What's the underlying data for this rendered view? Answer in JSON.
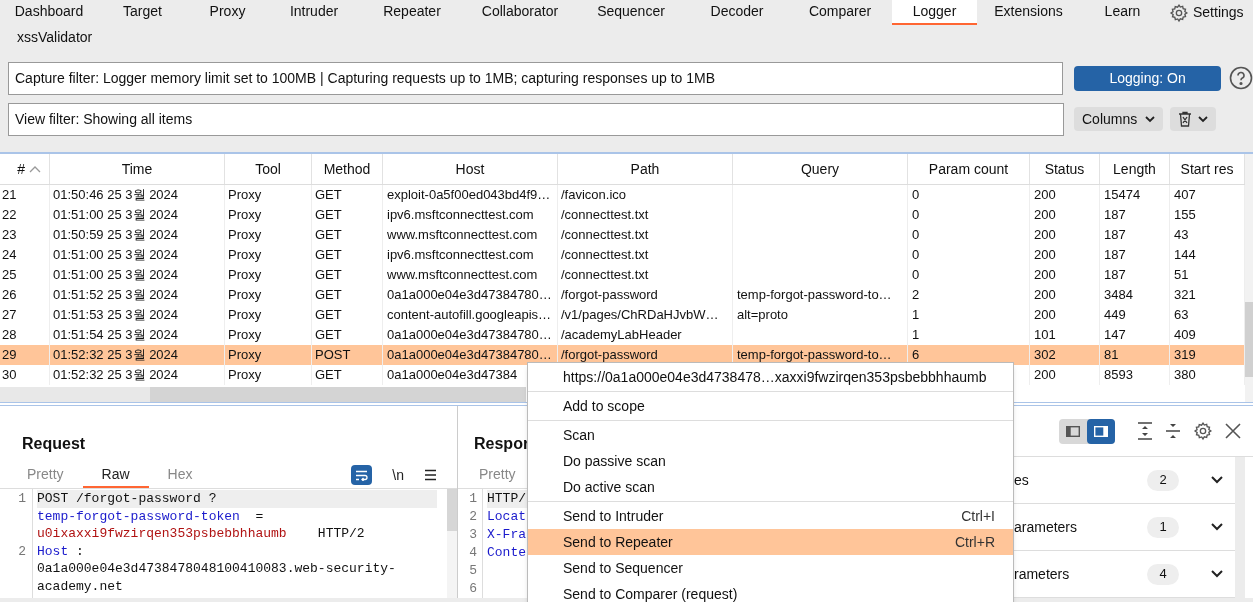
{
  "tabs": [
    {
      "label": "Dashboard",
      "selected": false
    },
    {
      "label": "Target",
      "selected": false
    },
    {
      "label": "Proxy",
      "selected": false
    },
    {
      "label": "Intruder",
      "selected": false
    },
    {
      "label": "Repeater",
      "selected": false
    },
    {
      "label": "Collaborator",
      "selected": false
    },
    {
      "label": "Sequencer",
      "selected": false
    },
    {
      "label": "Decoder",
      "selected": false
    },
    {
      "label": "Comparer",
      "selected": false
    },
    {
      "label": "Logger",
      "selected": true
    },
    {
      "label": "Extensions",
      "selected": false
    },
    {
      "label": "Learn",
      "selected": false
    }
  ],
  "settings": {
    "label": "Settings"
  },
  "tabs_row2": [
    {
      "label": "xssValidator",
      "selected": false
    }
  ],
  "capture_filter": "Capture filter: Logger memory limit set to 100MB | Capturing requests up to 1MB;  capturing responses up to 1MB",
  "logging_button": {
    "label": "Logging: On",
    "on": true
  },
  "view_filter": "View filter: Showing all items",
  "columns_button": "Columns",
  "table": {
    "columns": [
      "#",
      "Time",
      "Tool",
      "Method",
      "Host",
      "Path",
      "Query",
      "Param count",
      "Status",
      "Length",
      "Start res"
    ],
    "rows": [
      {
        "selected": false,
        "cells": [
          "21",
          "01:50:46 25 3월 2024",
          "Proxy",
          "GET",
          "exploit-0a5f00ed043bd4f9…",
          "/favicon.ico",
          "",
          "0",
          "200",
          "15474",
          "407"
        ]
      },
      {
        "selected": false,
        "cells": [
          "22",
          "01:51:00 25 3월 2024",
          "Proxy",
          "GET",
          "ipv6.msftconnecttest.com",
          "/connecttest.txt",
          "",
          "0",
          "200",
          "187",
          "155"
        ]
      },
      {
        "selected": false,
        "cells": [
          "23",
          "01:50:59 25 3월 2024",
          "Proxy",
          "GET",
          "www.msftconnecttest.com",
          "/connecttest.txt",
          "",
          "0",
          "200",
          "187",
          "43"
        ]
      },
      {
        "selected": false,
        "cells": [
          "24",
          "01:51:00 25 3월 2024",
          "Proxy",
          "GET",
          "ipv6.msftconnecttest.com",
          "/connecttest.txt",
          "",
          "0",
          "200",
          "187",
          "144"
        ]
      },
      {
        "selected": false,
        "cells": [
          "25",
          "01:51:00 25 3월 2024",
          "Proxy",
          "GET",
          "www.msftconnecttest.com",
          "/connecttest.txt",
          "",
          "0",
          "200",
          "187",
          "51"
        ]
      },
      {
        "selected": false,
        "cells": [
          "26",
          "01:51:52 25 3월 2024",
          "Proxy",
          "GET",
          "0a1a000e04e3d47384780…",
          "/forgot-password",
          "temp-forgot-password-to…",
          "2",
          "200",
          "3484",
          "321"
        ]
      },
      {
        "selected": false,
        "cells": [
          "27",
          "01:51:53 25 3월 2024",
          "Proxy",
          "GET",
          "content-autofill.googleapis…",
          "/v1/pages/ChRDaHJvbW…",
          "alt=proto",
          "1",
          "200",
          "449",
          "63"
        ]
      },
      {
        "selected": false,
        "cells": [
          "28",
          "01:51:54 25 3월 2024",
          "Proxy",
          "GET",
          "0a1a000e04e3d47384780…",
          "/academyLabHeader",
          "",
          "1",
          "101",
          "147",
          "409"
        ]
      },
      {
        "selected": true,
        "cells": [
          "29",
          "01:52:32 25 3월 2024",
          "Proxy",
          "POST",
          "0a1a000e04e3d47384780…",
          "/forgot-password",
          "temp-forgot-password-to…",
          "6",
          "302",
          "81",
          "319"
        ]
      },
      {
        "selected": false,
        "cells": [
          "30",
          "01:52:32 25 3월 2024",
          "Proxy",
          "GET",
          "0a1a000e04e3d47384",
          "",
          "",
          "",
          "200",
          "8593",
          "380"
        ]
      }
    ]
  },
  "request": {
    "title": "Request",
    "tabs": [
      {
        "label": "Pretty",
        "selected": false
      },
      {
        "label": "Raw",
        "selected": true
      },
      {
        "label": "Hex",
        "selected": false
      }
    ],
    "wrap_on": true,
    "newline_label": "\\n",
    "lines": [
      {
        "number": "1",
        "rows": [
          [
            {
              "kind": "plain",
              "text": "POST /forgot-password ?"
            }
          ],
          [
            {
              "kind": "key",
              "text": "temp-forgot-password-token"
            },
            {
              "kind": "plain",
              "text": "  ="
            }
          ],
          [
            {
              "kind": "value",
              "text": "u0ixaxxi9fwzirqen353psbebbhhaumb"
            },
            {
              "kind": "plain",
              "text": "    HTTP/2"
            }
          ]
        ]
      },
      {
        "number": "2",
        "rows": [
          [
            {
              "kind": "key",
              "text": "Host"
            },
            {
              "kind": "plain",
              "text": " :"
            }
          ],
          [
            {
              "kind": "plain",
              "text": "0a1a000e04e3d4738478048100410083.web-security-"
            }
          ],
          [
            {
              "kind": "plain",
              "text": "academy.net"
            }
          ]
        ]
      }
    ]
  },
  "response": {
    "title": "Respor",
    "tabs": [
      {
        "label": "Pretty",
        "selected": false
      }
    ],
    "lines": [
      {
        "number": "1",
        "text": "HTTP/",
        "kind": "plain"
      },
      {
        "number": "2",
        "text": "Locat",
        "kind": "key"
      },
      {
        "number": "3",
        "text": "X-Fra",
        "kind": "key"
      },
      {
        "number": "4",
        "text": "Conte",
        "kind": "key"
      },
      {
        "number": "5"
      },
      {
        "number": "6"
      }
    ]
  },
  "inspector": {
    "layout_toggle": [
      {
        "selected": false
      },
      {
        "selected": true
      }
    ],
    "sections": [
      {
        "label": "es",
        "count": "2"
      },
      {
        "label": "arameters",
        "count": "1"
      },
      {
        "label": "rameters",
        "count": "4"
      }
    ]
  },
  "context_menu": {
    "groups": [
      [
        {
          "label": "https://0a1a000e04e3d4738478…xaxxi9fwzirqen353psbebbhhaumb",
          "selected": false
        }
      ],
      [
        {
          "label": "Add to scope",
          "selected": false
        }
      ],
      [
        {
          "label": "Scan",
          "selected": false
        },
        {
          "label": "Do passive scan",
          "selected": false
        },
        {
          "label": "Do active scan",
          "selected": false
        }
      ],
      [
        {
          "label": "Send to Intruder",
          "shortcut": "Ctrl+I",
          "selected": false
        },
        {
          "label": "Send to Repeater",
          "shortcut": "Ctrl+R",
          "selected": true
        },
        {
          "label": "Send to Sequencer",
          "selected": false
        },
        {
          "label": "Send to Comparer (request)",
          "selected": false
        }
      ]
    ]
  }
}
